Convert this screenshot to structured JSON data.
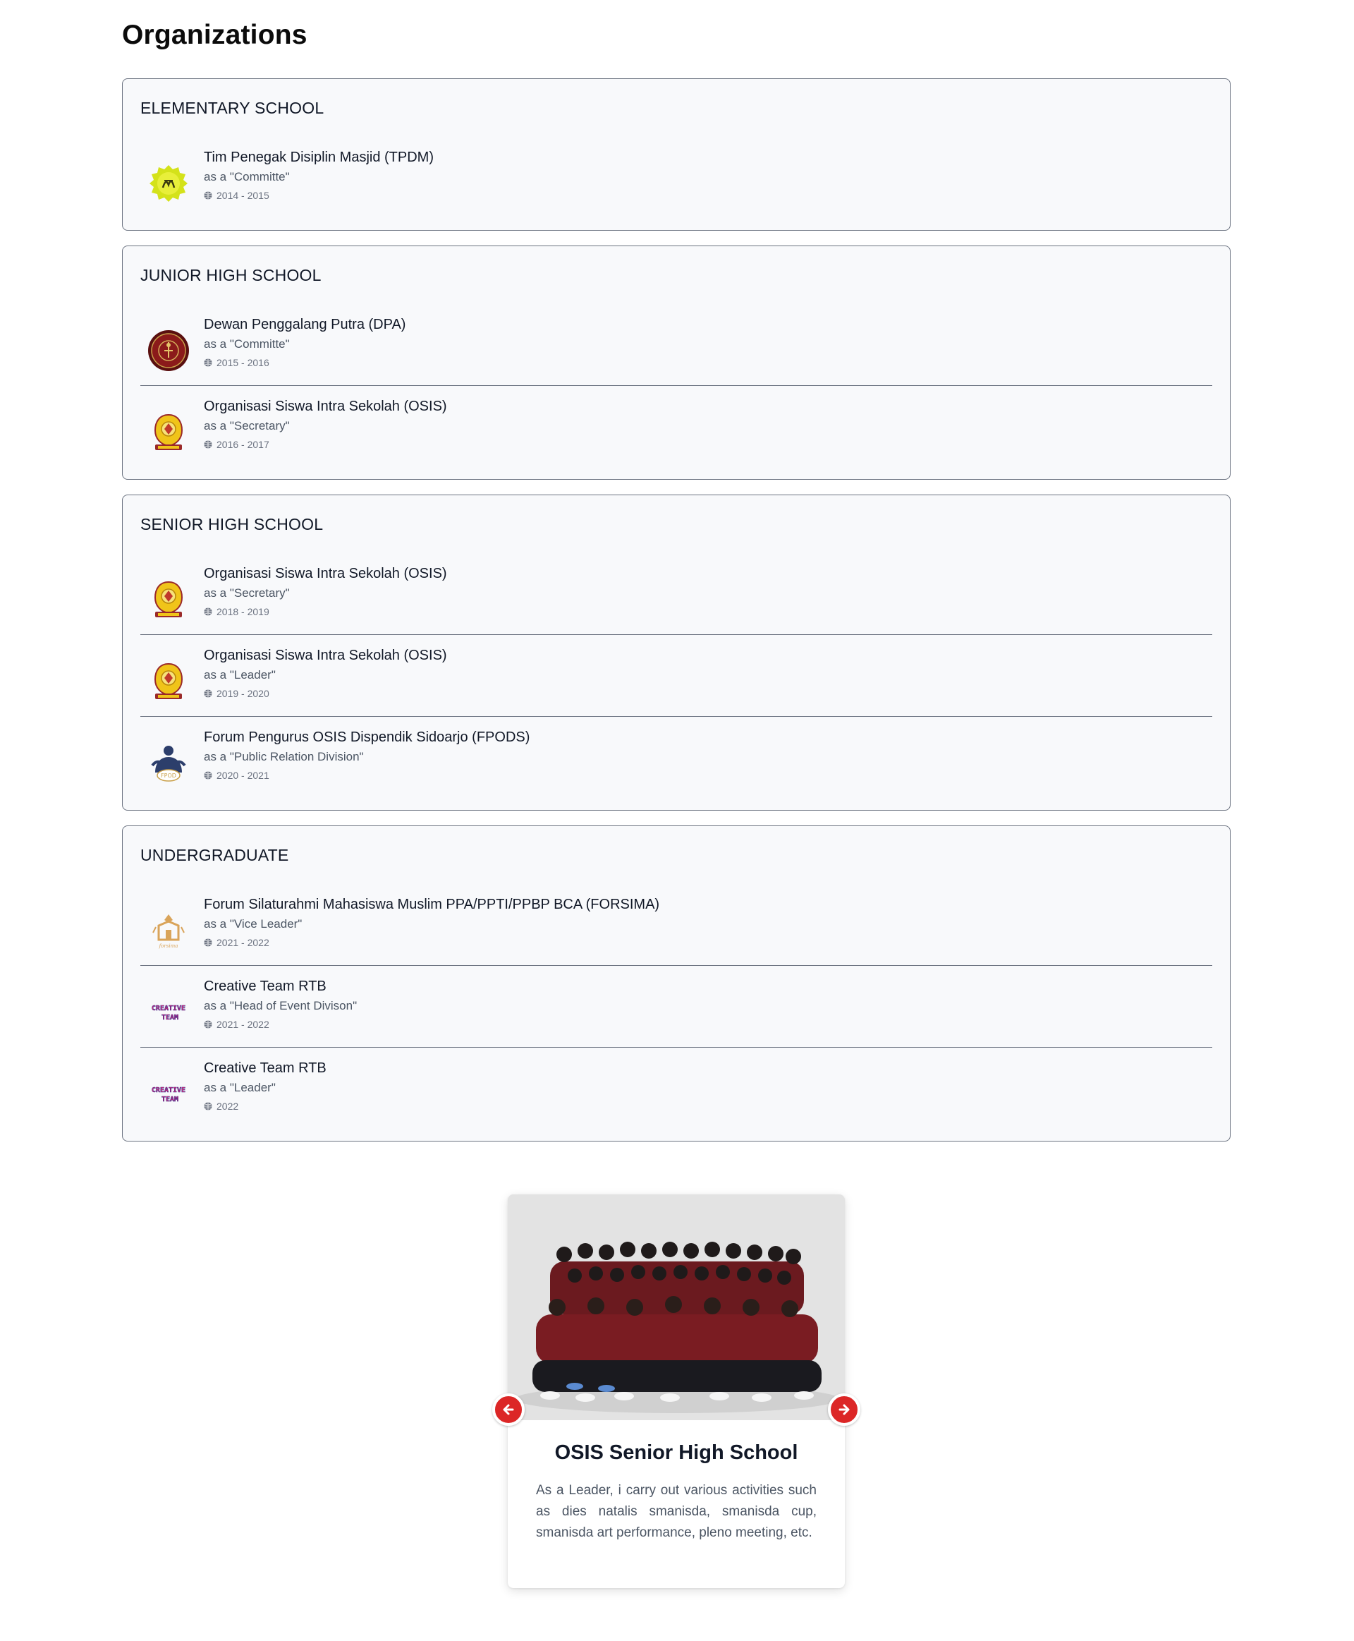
{
  "page": {
    "title": "Organizations"
  },
  "sections": [
    {
      "heading": "ELEMENTARY SCHOOL",
      "items": [
        {
          "name": "Tim Penegak Disiplin Masjid (TPDM)",
          "role": "as a \"Committe\"",
          "period": "2014 - 2015",
          "logo": "tpdm-logo-icon"
        }
      ]
    },
    {
      "heading": "JUNIOR HIGH SCHOOL",
      "items": [
        {
          "name": "Dewan Penggalang Putra (DPA)",
          "role": "as a \"Committe\"",
          "period": "2015 - 2016",
          "logo": "dpa-logo-icon"
        },
        {
          "name": "Organisasi Siswa Intra Sekolah (OSIS)",
          "role": "as a \"Secretary\"",
          "period": "2016 - 2017",
          "logo": "osis-logo-icon"
        }
      ]
    },
    {
      "heading": "SENIOR HIGH SCHOOL",
      "items": [
        {
          "name": "Organisasi Siswa Intra Sekolah (OSIS)",
          "role": "as a \"Secretary\"",
          "period": "2018 - 2019",
          "logo": "osis-logo-icon"
        },
        {
          "name": "Organisasi Siswa Intra Sekolah (OSIS)",
          "role": "as a \"Leader\"",
          "period": "2019 - 2020",
          "logo": "osis-logo-icon"
        },
        {
          "name": "Forum Pengurus OSIS Dispendik Sidoarjo (FPODS)",
          "role": "as a \"Public Relation Division\"",
          "period": "2020 - 2021",
          "logo": "fpods-logo-icon"
        }
      ]
    },
    {
      "heading": "UNDERGRADUATE",
      "items": [
        {
          "name": "Forum Silaturahmi Mahasiswa Muslim PPA/PPTI/PPBP BCA (FORSIMA)",
          "role": "as a \"Vice Leader\"",
          "period": "2021 - 2022",
          "logo": "forsima-logo-icon"
        },
        {
          "name": "Creative Team RTB",
          "role": "as a \"Head of Event Divison\"",
          "period": "2021 - 2022",
          "logo": "creative-team-logo-icon"
        },
        {
          "name": "Creative Team RTB",
          "role": "as a \"Leader\"",
          "period": "2022",
          "logo": "creative-team-logo-icon"
        }
      ]
    }
  ],
  "carousel": {
    "title": "OSIS Senior High School",
    "description": "As a Leader, i carry out various activities such as dies natalis smanisda, smanisda cup, smanisda art performance, pleno meeting, etc.",
    "prev_icon": "arrow-left-icon",
    "next_icon": "arrow-right-icon"
  },
  "colors": {
    "accent": "#dc2626",
    "card_bg": "#f8f9fb",
    "border": "#6b7280"
  }
}
